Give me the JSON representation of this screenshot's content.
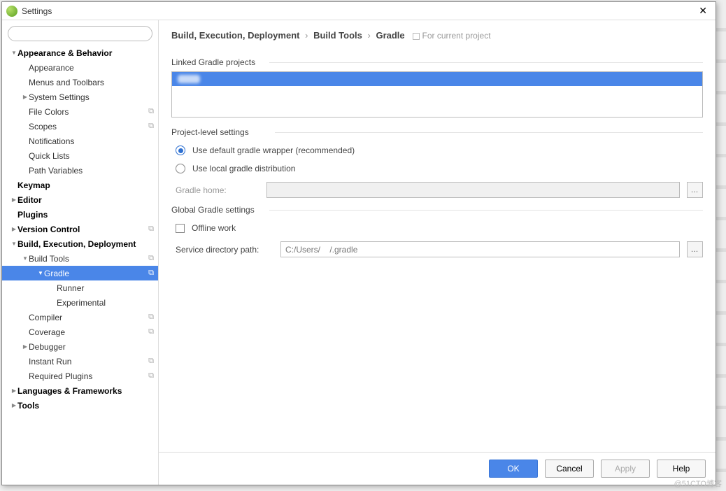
{
  "window": {
    "title": "Settings"
  },
  "search": {
    "placeholder": ""
  },
  "tree": [
    {
      "label": "Appearance & Behavior",
      "level": 1,
      "bold": true,
      "arrow": "▼"
    },
    {
      "label": "Appearance",
      "level": 2
    },
    {
      "label": "Menus and Toolbars",
      "level": 2
    },
    {
      "label": "System Settings",
      "level": 2,
      "arrow": "▶"
    },
    {
      "label": "File Colors",
      "level": 2,
      "copy": true
    },
    {
      "label": "Scopes",
      "level": 2,
      "copy": true
    },
    {
      "label": "Notifications",
      "level": 2
    },
    {
      "label": "Quick Lists",
      "level": 2
    },
    {
      "label": "Path Variables",
      "level": 2
    },
    {
      "label": "Keymap",
      "level": 1,
      "bold": true
    },
    {
      "label": "Editor",
      "level": 1,
      "bold": true,
      "arrow": "▶"
    },
    {
      "label": "Plugins",
      "level": 1,
      "bold": true
    },
    {
      "label": "Version Control",
      "level": 1,
      "bold": true,
      "arrow": "▶",
      "copy": true
    },
    {
      "label": "Build, Execution, Deployment",
      "level": 1,
      "bold": true,
      "arrow": "▼"
    },
    {
      "label": "Build Tools",
      "level": 2,
      "arrow": "▼",
      "copy": true
    },
    {
      "label": "Gradle",
      "level": 3,
      "arrow": "▼",
      "copy": true,
      "selected": true
    },
    {
      "label": "Runner",
      "level": 4
    },
    {
      "label": "Experimental",
      "level": 4
    },
    {
      "label": "Compiler",
      "level": 2,
      "copy": true
    },
    {
      "label": "Coverage",
      "level": 2,
      "copy": true
    },
    {
      "label": "Debugger",
      "level": 2,
      "arrow": "▶"
    },
    {
      "label": "Instant Run",
      "level": 2,
      "copy": true
    },
    {
      "label": "Required Plugins",
      "level": 2,
      "copy": true
    },
    {
      "label": "Languages & Frameworks",
      "level": 1,
      "bold": true,
      "arrow": "▶"
    },
    {
      "label": "Tools",
      "level": 1,
      "bold": true,
      "arrow": "▶"
    }
  ],
  "breadcrumb": {
    "parts": [
      "Build, Execution, Deployment",
      "Build Tools",
      "Gradle"
    ],
    "hint": "For current project"
  },
  "panel": {
    "linked_label": "Linked Gradle projects",
    "project_level_label": "Project-level settings",
    "radio_default": "Use default gradle wrapper (recommended)",
    "radio_local": "Use local gradle distribution",
    "gradle_home_label": "Gradle home:",
    "gradle_home_value": "",
    "global_label": "Global Gradle settings",
    "offline_label": "Offline work",
    "service_dir_label": "Service directory path:",
    "service_dir_value": "C:/Users/    /.gradle"
  },
  "buttons": {
    "ok": "OK",
    "cancel": "Cancel",
    "apply": "Apply",
    "help": "Help"
  },
  "watermark": "@51CTO博客"
}
